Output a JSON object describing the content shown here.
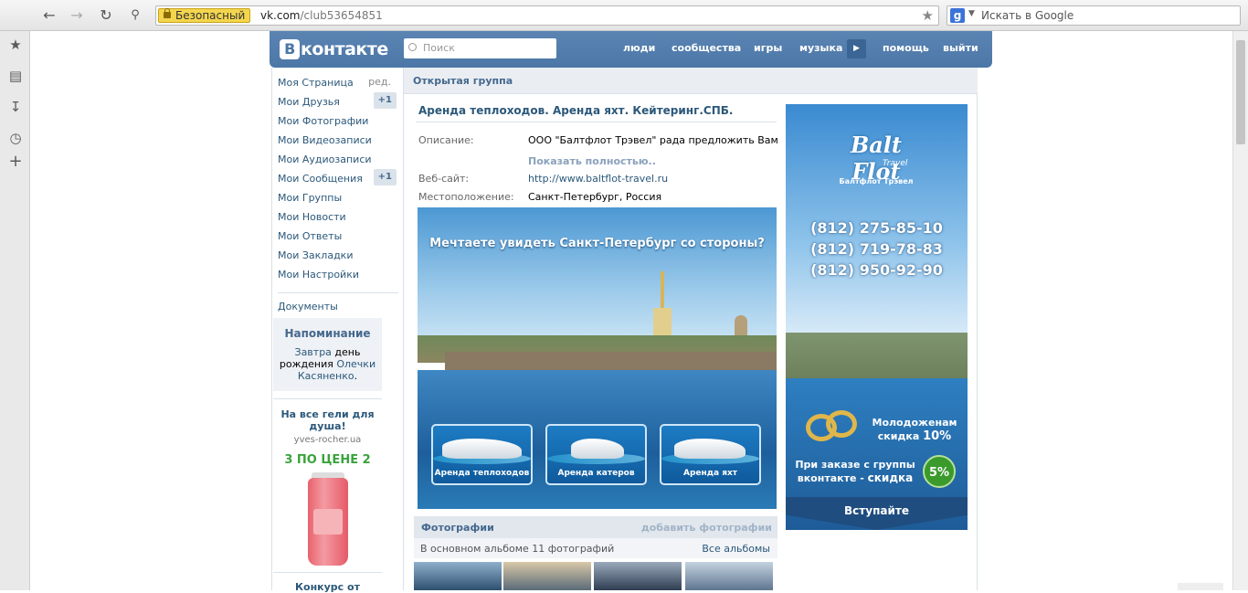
{
  "browser": {
    "secure_label": "Безопасный",
    "url_domain": "vk.com",
    "url_path": "/club53654851",
    "search_placeholder": "Искать в Google"
  },
  "vk": {
    "logo": "контакте",
    "logo_box": "В",
    "search_placeholder": "Поиск",
    "nav": [
      "люди",
      "сообщества",
      "игры",
      "музыка",
      "помощь",
      "выйти"
    ]
  },
  "menu": {
    "items": [
      {
        "label": "Моя Страница",
        "extra": "ред."
      },
      {
        "label": "Мои Друзья",
        "badge": "+1"
      },
      {
        "label": "Мои Фотографии"
      },
      {
        "label": "Мои Видеозаписи"
      },
      {
        "label": "Мои Аудиозаписи"
      },
      {
        "label": "Мои Сообщения",
        "badge": "+1"
      },
      {
        "label": "Мои Группы"
      },
      {
        "label": "Мои Новости"
      },
      {
        "label": "Мои Ответы"
      },
      {
        "label": "Мои Закладки"
      },
      {
        "label": "Мои Настройки"
      }
    ],
    "documents": "Документы"
  },
  "reminder": {
    "title": "Напоминание",
    "word_tomorrow": "Завтра",
    "text_mid": " день рождения ",
    "person": "Олечки Касяненко",
    "dot": "."
  },
  "ad": {
    "title": "На все гели для душа!",
    "domain": "yves-rocher.ua",
    "promo": "3 ПО ЦЕНЕ 2",
    "next_title": "Конкурс от"
  },
  "group": {
    "section": "Открытая группа",
    "title": "Аренда теплоходов. Аренда яхт. Кейтеринг.СПБ.",
    "desc_label": "Описание:",
    "desc_value": "ООО \"Балтфлот Трэвел\" рада предложить Вам",
    "show_more": "Показать полностью..",
    "site_label": "Веб-сайт:",
    "site_value": "http://www.baltflot-travel.ru",
    "loc_label": "Местоположение:",
    "loc_value": "Санкт-Петербург, Россия"
  },
  "banner": {
    "question": "Мечтаете увидеть Санкт-Петербург со стороны?",
    "cards": [
      "Аренда теплоходов",
      "Аренда катеров",
      "Аренда яхт"
    ]
  },
  "photos": {
    "title": "Фотографии",
    "add": "добавить фотографии",
    "subtitle": "В основном альбоме 11 фотографий",
    "all": "Все альбомы"
  },
  "side_banner": {
    "logo_main": "Balt Flot",
    "logo_travel": "Travel",
    "logo_ru": "Балтфлот Трэвел",
    "phones": [
      "(812) 275-85-10",
      "(812) 719-78-83",
      "(812) 950-92-90"
    ],
    "wed_line1": "Молодоженам",
    "wed_line2": "скидка",
    "wed_pct": "10%",
    "group_line1": "При заказе с группы",
    "group_line2": "вконтакте - ",
    "group_bold": "скидка",
    "group_pct": "5%",
    "join": "Вступайте"
  }
}
